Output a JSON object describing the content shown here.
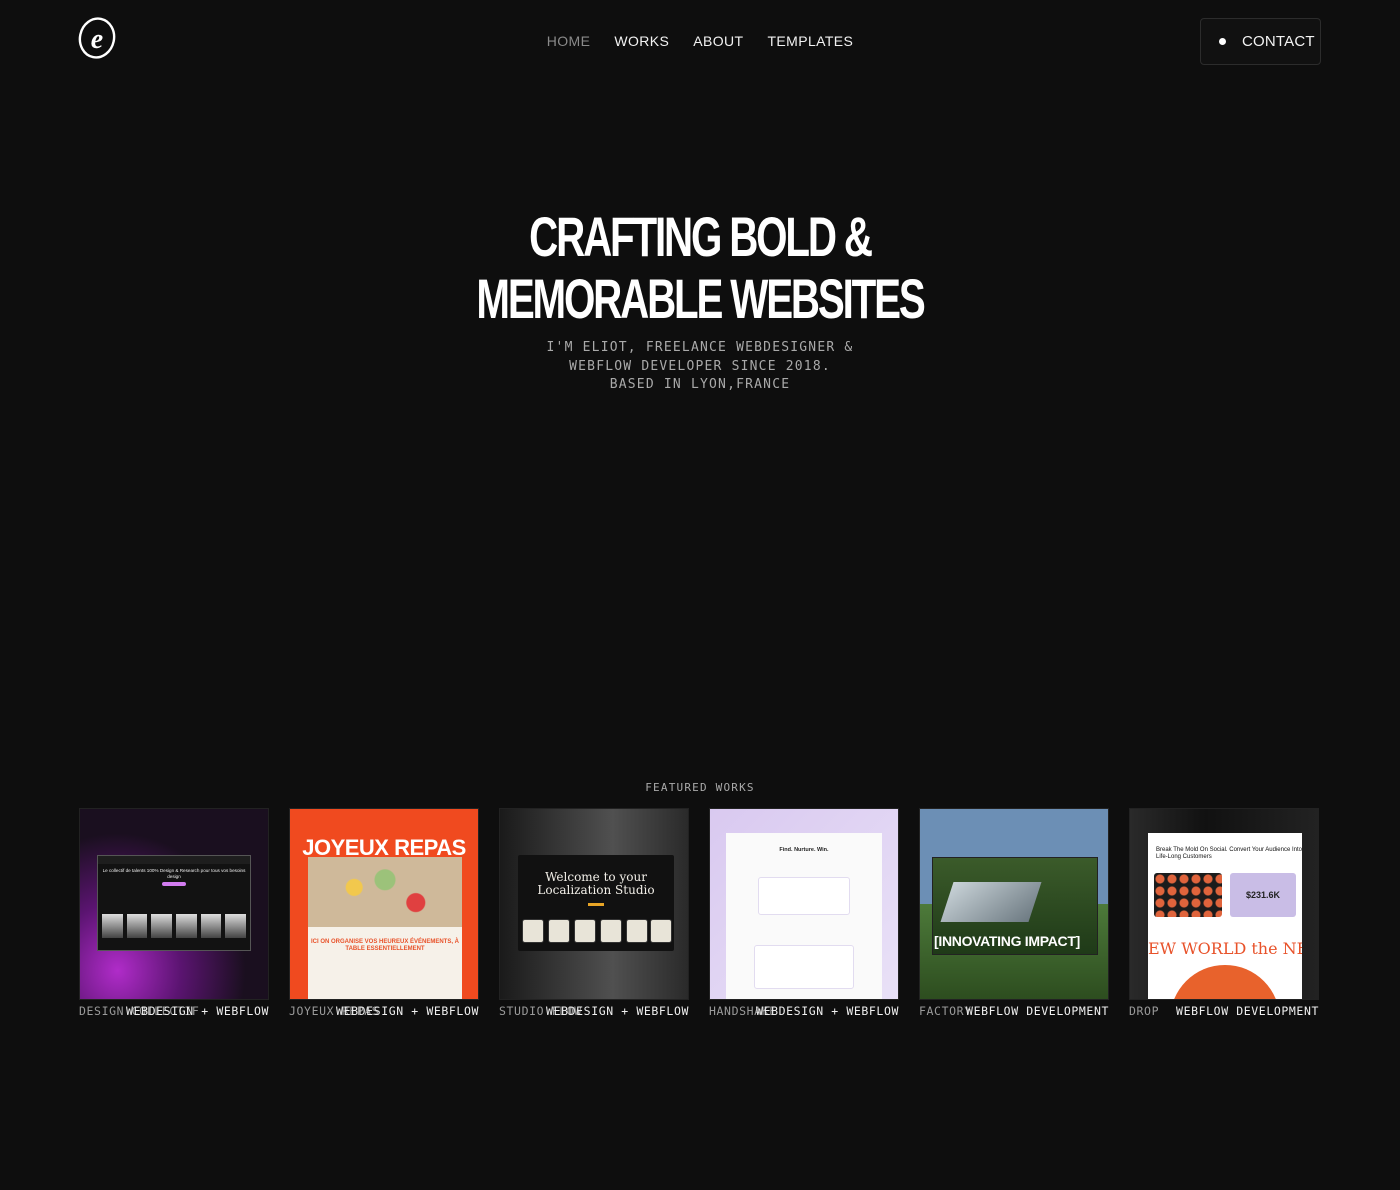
{
  "nav": {
    "logo_letter": "e",
    "items": [
      "HOME",
      "WORKS",
      "ABOUT",
      "TEMPLATES"
    ],
    "contact_label": "CONTACT"
  },
  "hero": {
    "title_lines": [
      "CRAFTING BOLD &",
      "MEMORABLE WEBSITES"
    ],
    "subtitle_lines": [
      "I'M ELIOT, FREELANCE WEBDESIGNER &",
      "WEBFLOW DEVELOPER SINCE 2018.",
      "BASED IN LYON,FRANCE"
    ]
  },
  "featured": {
    "label": "FEATURED WORKS",
    "works": [
      {
        "name": "DESIGN COLLECTIF",
        "tag": "WEBDESIGN + WEBFLOW",
        "thumb_text": "Le collectif de talents 100% Design & Research pour tous vos besoins design"
      },
      {
        "name": "JOYEUX REPAS",
        "tag": "WEBDESIGN + WEBFLOW",
        "thumb_title": "JOYEUX REPAS",
        "thumb_text": "ICI ON ORGANISE VOS HEUREUX ÉVÉNEMENTS, À TABLE ESSENTIELLEMENT"
      },
      {
        "name": "STUDIO FLOW",
        "tag": "WEBDESIGN + WEBFLOW",
        "thumb_text": "Welcome to your Localization Studio"
      },
      {
        "name": "HANDSHAKE",
        "tag": "WEBDESIGN + WEBFLOW",
        "thumb_text": "Find. Nurture. Win."
      },
      {
        "name": "FACTORY",
        "tag": "WEBFLOW DEVELOPMENT",
        "thumb_text": "[INNOVATING IMPACT]"
      },
      {
        "name": "DROP",
        "tag": "WEBFLOW DEVELOPMENT",
        "thumb_text": "Break The Mold On Social. Convert Your Audience Into Life-Long Customers",
        "thumb_price": "$231.6K",
        "thumb_banner": "EW WORLD the NEW W"
      }
    ]
  },
  "colors": {
    "background": "#0e0e0e",
    "accent_orange": "#f04a1f",
    "accent_purple": "#b02cc9"
  }
}
